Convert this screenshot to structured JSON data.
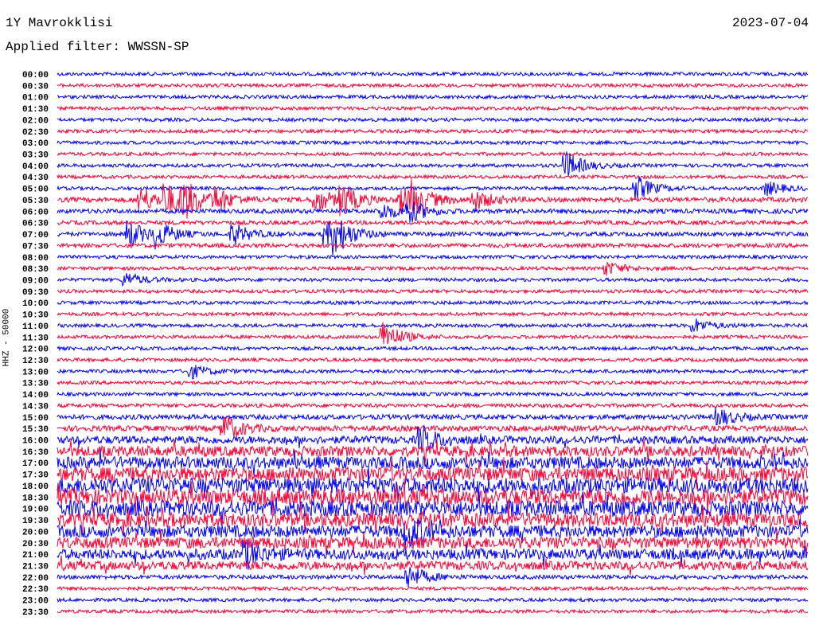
{
  "header": {
    "station": "1Y Mavrokklisi",
    "date": "2023-07-04",
    "filter": "Applied filter: WWSSN-SP"
  },
  "chart_data": {
    "type": "line",
    "title": "1Y Mavrokklisi",
    "subtitle": "Applied filter: WWSSN-SP",
    "ylabel": "HHZ - 50000",
    "xlabel": "",
    "minutes_per_row": 30,
    "colors": [
      "#0000ff",
      "#ff0033"
    ],
    "row_labels": [
      "00:00",
      "00:30",
      "01:00",
      "01:30",
      "02:00",
      "02:30",
      "03:00",
      "03:30",
      "04:00",
      "04:30",
      "05:00",
      "05:30",
      "06:00",
      "06:30",
      "07:00",
      "07:30",
      "08:00",
      "08:30",
      "09:00",
      "09:30",
      "10:00",
      "10:30",
      "11:00",
      "11:30",
      "12:00",
      "12:30",
      "13:00",
      "13:30",
      "14:00",
      "14:30",
      "15:00",
      "15:30",
      "16:00",
      "16:30",
      "17:00",
      "17:30",
      "18:00",
      "18:30",
      "19:00",
      "19:30",
      "20:00",
      "20:30",
      "21:00",
      "21:30",
      "22:00",
      "22:30",
      "23:00",
      "23:30"
    ],
    "row_noise": [
      1,
      1,
      1,
      1,
      1,
      1,
      1,
      1,
      1,
      1,
      1,
      1.4,
      1.3,
      1.2,
      1.2,
      1.2,
      1,
      1,
      1,
      1,
      1,
      1,
      1,
      1,
      1,
      1,
      1,
      1,
      1,
      1.1,
      1.4,
      1.6,
      2.2,
      3,
      3.5,
      4,
      4.5,
      4.5,
      4.5,
      4,
      3.5,
      3.3,
      3,
      2.5,
      1.2,
      1,
      1,
      1
    ],
    "events": [
      {
        "row": "04:00",
        "minute": 20.4,
        "amp": 16
      },
      {
        "row": "05:00",
        "minute": 23.2,
        "amp": 14
      },
      {
        "row": "05:00",
        "minute": 28.4,
        "amp": 8
      },
      {
        "row": "05:30",
        "minute": 3.4,
        "amp": 14
      },
      {
        "row": "05:30",
        "minute": 4.4,
        "amp": 16
      },
      {
        "row": "05:30",
        "minute": 5.1,
        "amp": 20
      },
      {
        "row": "05:30",
        "minute": 6.4,
        "amp": 12
      },
      {
        "row": "05:30",
        "minute": 10.4,
        "amp": 14
      },
      {
        "row": "05:30",
        "minute": 11.4,
        "amp": 16
      },
      {
        "row": "05:30",
        "minute": 13.8,
        "amp": 16
      },
      {
        "row": "05:30",
        "minute": 14.3,
        "amp": 14
      },
      {
        "row": "05:30",
        "minute": 16.7,
        "amp": 12
      },
      {
        "row": "06:00",
        "minute": 13.0,
        "amp": 10
      },
      {
        "row": "06:00",
        "minute": 14.1,
        "amp": 12
      },
      {
        "row": "07:00",
        "minute": 2.9,
        "amp": 16
      },
      {
        "row": "07:00",
        "minute": 4.0,
        "amp": 14
      },
      {
        "row": "07:00",
        "minute": 7.1,
        "amp": 12
      },
      {
        "row": "07:00",
        "minute": 10.8,
        "amp": 14
      },
      {
        "row": "07:00",
        "minute": 11.2,
        "amp": 16
      },
      {
        "row": "08:30",
        "minute": 22.0,
        "amp": 8
      },
      {
        "row": "09:00",
        "minute": 2.8,
        "amp": 8
      },
      {
        "row": "11:00",
        "minute": 25.5,
        "amp": 8
      },
      {
        "row": "11:30",
        "minute": 13.1,
        "amp": 18
      },
      {
        "row": "13:00",
        "minute": 5.4,
        "amp": 8
      },
      {
        "row": "15:00",
        "minute": 26.5,
        "amp": 10
      },
      {
        "row": "15:30",
        "minute": 6.7,
        "amp": 16
      },
      {
        "row": "16:00",
        "minute": 14.6,
        "amp": 14
      },
      {
        "row": "20:00",
        "minute": 14.0,
        "amp": 18
      },
      {
        "row": "21:00",
        "minute": 7.6,
        "amp": 14
      },
      {
        "row": "22:00",
        "minute": 14.1,
        "amp": 14
      }
    ]
  }
}
